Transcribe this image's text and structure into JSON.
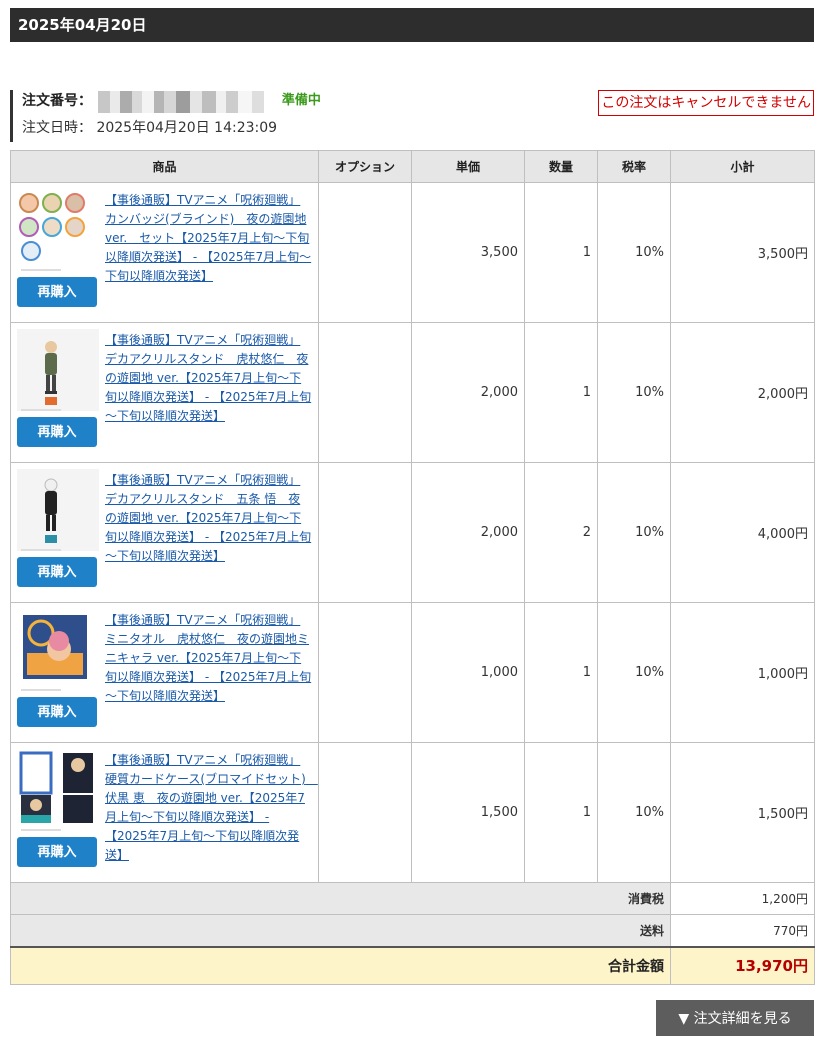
{
  "header": {
    "date": "2025年04月20日"
  },
  "order": {
    "number_label": "注文番号：",
    "status": "準備中",
    "date_label": "注文日時：",
    "date_value": "2025年04月20日 14:23:09",
    "cancel_note": "この注文はキャンセルできません"
  },
  "table": {
    "headers": [
      "商品",
      "オプション",
      "単価",
      "数量",
      "税率",
      "小計"
    ],
    "rebuy_label": "再購入",
    "rows": [
      {
        "name": "【事後通販】TVアニメ「呪術廻戦」カンバッジ(ブラインド)　夜の遊園地ver.　セット【2025年7月上旬～下旬以降順次発送】 - 【2025年7月上旬～下旬以降順次発送】",
        "option": "",
        "price": "3,500",
        "qty": "1",
        "tax": "10%",
        "subtotal": "3,500円",
        "thumb": "badge-set-icon"
      },
      {
        "name": "【事後通販】TVアニメ「呪術廻戦」デカアクリルスタンド　虎杖悠仁　夜の遊園地 ver.【2025年7月上旬～下旬以降順次発送】 - 【2025年7月上旬～下旬以降順次発送】",
        "option": "",
        "price": "2,000",
        "qty": "1",
        "tax": "10%",
        "subtotal": "2,000円",
        "thumb": "acrylic-stand-icon"
      },
      {
        "name": "【事後通販】TVアニメ「呪術廻戦」デカアクリルスタンド　五条 悟　夜の遊園地 ver.【2025年7月上旬～下旬以降順次発送】 - 【2025年7月上旬～下旬以降順次発送】",
        "option": "",
        "price": "2,000",
        "qty": "2",
        "tax": "10%",
        "subtotal": "4,000円",
        "thumb": "acrylic-stand-icon"
      },
      {
        "name": "【事後通販】TVアニメ「呪術廻戦」ミニタオル　虎杖悠仁　夜の遊園地ミニキャラ ver.【2025年7月上旬～下旬以降順次発送】 - 【2025年7月上旬～下旬以降順次発送】",
        "option": "",
        "price": "1,000",
        "qty": "1",
        "tax": "10%",
        "subtotal": "1,000円",
        "thumb": "mini-towel-icon"
      },
      {
        "name": "【事後通販】TVアニメ「呪術廻戦」硬質カードケース(ブロマイドセット)　伏黒 恵　夜の遊園地 ver.【2025年7月上旬～下旬以降順次発送】 - 【2025年7月上旬～下旬以降順次発送】",
        "option": "",
        "price": "1,500",
        "qty": "1",
        "tax": "10%",
        "subtotal": "1,500円",
        "thumb": "card-case-icon"
      }
    ]
  },
  "summary": {
    "tax_label": "消費税",
    "tax_value": "1,200円",
    "shipping_label": "送料",
    "shipping_value": "770円",
    "total_label": "合計金額",
    "total_value": "13,970円"
  },
  "detail_button": "▼ 注文詳細を見る"
}
